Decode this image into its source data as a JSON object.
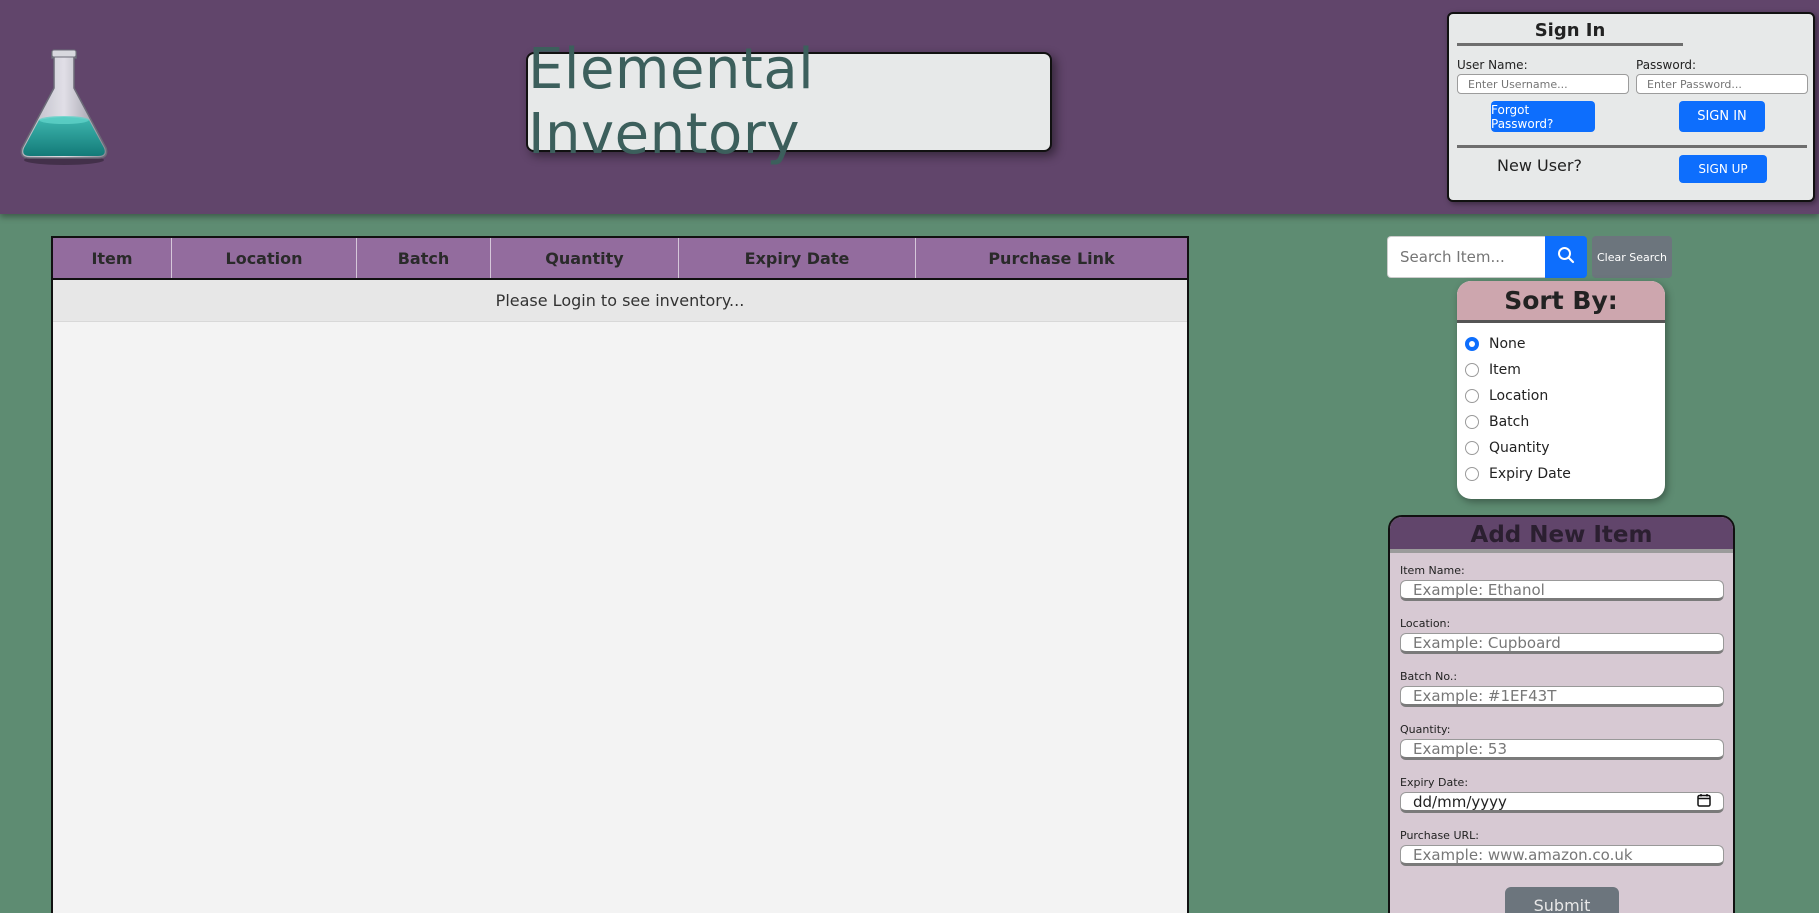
{
  "header": {
    "title": "Elemental Inventory",
    "logo_icon": "flask-icon"
  },
  "signin": {
    "heading": "Sign In",
    "username_label": "User Name:",
    "username_placeholder": "Enter Username...",
    "password_label": "Password:",
    "password_placeholder": "Enter Password...",
    "forgot_label": "Forgot Password?",
    "signin_label": "SIGN IN",
    "newuser_label": "New User?",
    "signup_label": "SIGN UP"
  },
  "table": {
    "columns": [
      "Item",
      "Location",
      "Batch",
      "Quantity",
      "Expiry Date",
      "Purchase Link"
    ],
    "empty_message": "Please Login to see inventory..."
  },
  "search": {
    "placeholder": "Search Item...",
    "clear_label": "Clear Search",
    "icon": "search-icon"
  },
  "sort": {
    "heading": "Sort By:",
    "selected": "None",
    "options": [
      "None",
      "Item",
      "Location",
      "Batch",
      "Quantity",
      "Expiry Date"
    ]
  },
  "add_item": {
    "heading": "Add New Item",
    "fields": [
      {
        "label": "Item Name:",
        "placeholder": "Example: Ethanol"
      },
      {
        "label": "Location:",
        "placeholder": "Example: Cupboard"
      },
      {
        "label": "Batch No.:",
        "placeholder": "Example: #1EF43T"
      },
      {
        "label": "Quantity:",
        "placeholder": "Example: 53"
      },
      {
        "label": "Expiry Date:",
        "placeholder": "dd/mm/yyyy"
      },
      {
        "label": "Purchase URL:",
        "placeholder": "Example: www.amazon.co.uk"
      }
    ],
    "submit_label": "Submit"
  },
  "colors": {
    "header_bg": "#61456b",
    "page_bg": "#5e8c72",
    "table_header": "#936c9e",
    "accent_blue": "#0d6efd",
    "sort_head": "#cda6ae",
    "add_bg": "#d7c9d3"
  }
}
